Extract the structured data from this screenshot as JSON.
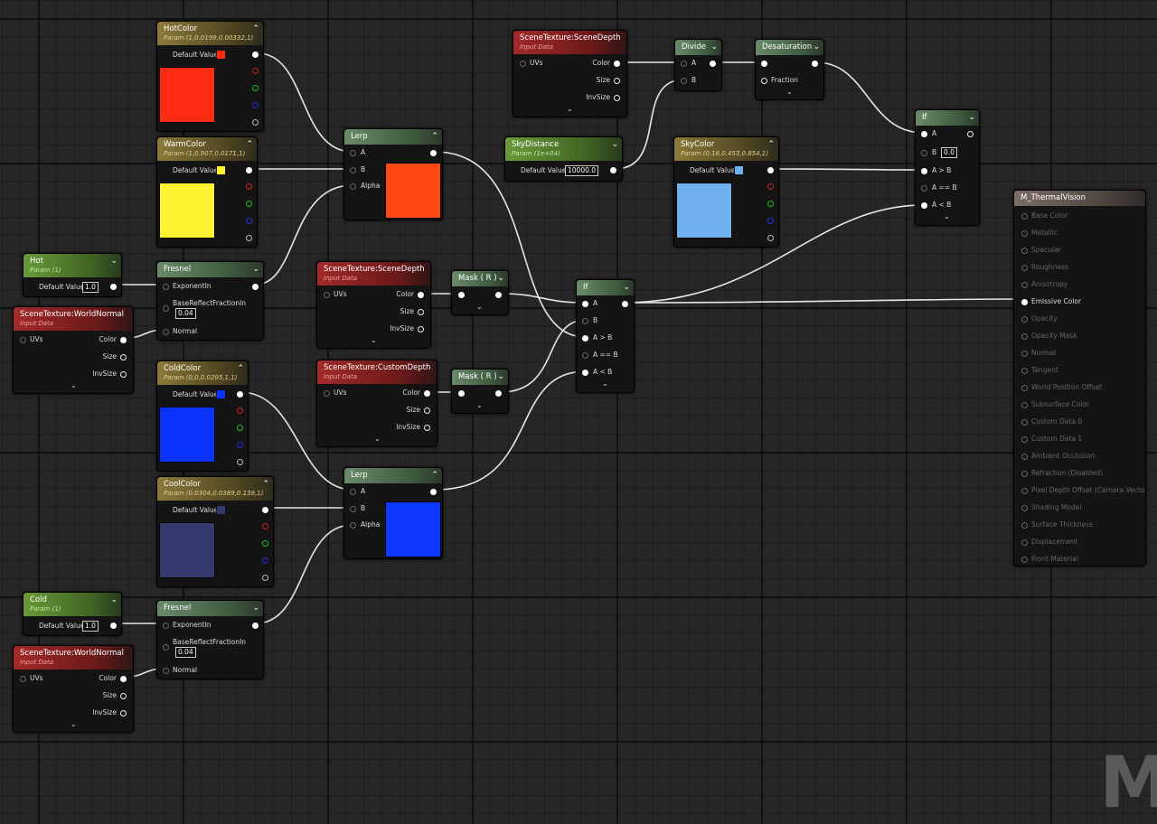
{
  "watermark": "M",
  "colors": {
    "hot": "#ff2b12",
    "warm": "#fff230",
    "cold": "#0a33ff",
    "cool": "#353a6e",
    "sky": "#6fb1ef",
    "lerp_top": "#ff4a14",
    "lerp_bot": "#0c38ff",
    "wire": "#e6e6e6"
  },
  "hot_color": {
    "title": "HotColor",
    "subtitle": "Param (1,0.0199,0.00332,1)",
    "default_label": "Default Value"
  },
  "warm_color": {
    "title": "WarmColor",
    "subtitle": "Param (1,0.907,0.0171,1)",
    "default_label": "Default Value"
  },
  "cold_color": {
    "title": "ColdColor",
    "subtitle": "Param (0,0,0.0295,1,1)",
    "default_label": "Default Value"
  },
  "cool_color": {
    "title": "CoolColor",
    "subtitle": "Param (0.0304,0.0389,0.139,1)",
    "default_label": "Default Value"
  },
  "hot_param": {
    "title": "Hot",
    "subtitle": "Param (1)",
    "default_label": "Default Value",
    "value": "1.0"
  },
  "cold_param": {
    "title": "Cold",
    "subtitle": "Param (1)",
    "default_label": "Default Value",
    "value": "1.0"
  },
  "world_normal_1": {
    "title": "SceneTexture:WorldNormal",
    "subtitle": "Input Data",
    "uvs": "UVs",
    "color": "Color",
    "size": "Size",
    "invsize": "InvSize"
  },
  "world_normal_2": {
    "title": "SceneTexture:WorldNormal",
    "subtitle": "Input Data",
    "uvs": "UVs",
    "color": "Color",
    "size": "Size",
    "invsize": "InvSize"
  },
  "fresnel_1": {
    "title": "Fresnel",
    "exponent": "ExponentIn",
    "base": "BaseReflectFractionIn",
    "base_value": "0.04",
    "normal": "Normal"
  },
  "fresnel_2": {
    "title": "Fresnel",
    "exponent": "ExponentIn",
    "base": "BaseReflectFractionIn",
    "base_value": "0.04",
    "normal": "Normal"
  },
  "lerp_1": {
    "title": "Lerp",
    "a": "A",
    "b": "B",
    "alpha": "Alpha"
  },
  "lerp_2": {
    "title": "Lerp",
    "a": "A",
    "b": "B",
    "alpha": "Alpha"
  },
  "scene_depth_1": {
    "title": "SceneTexture:SceneDepth",
    "subtitle": "Input Data",
    "uvs": "UVs",
    "color": "Color",
    "size": "Size",
    "invsize": "InvSize"
  },
  "scene_depth_2": {
    "title": "SceneTexture:SceneDepth",
    "subtitle": "Input Data",
    "uvs": "UVs",
    "color": "Color",
    "size": "Size",
    "invsize": "InvSize"
  },
  "custom_depth": {
    "title": "SceneTexture:CustomDepth",
    "subtitle": "Input Data",
    "uvs": "UVs",
    "color": "Color",
    "size": "Size",
    "invsize": "InvSize"
  },
  "mask_1": {
    "title": "Mask ( R )"
  },
  "mask_2": {
    "title": "Mask ( R )"
  },
  "if_main": {
    "title": "If",
    "a": "A",
    "b": "B",
    "agb": "A > B",
    "aeb": "A == B",
    "alb": "A < B"
  },
  "if_top": {
    "title": "If",
    "a": "A",
    "b": "B",
    "b_value": "0.0",
    "agb": "A > B",
    "aeb": "A == B",
    "alb": "A < B"
  },
  "sky_distance": {
    "title": "SkyDistance",
    "subtitle": "Param (1e+04)",
    "default_label": "Default Value",
    "value": "10000.0"
  },
  "sky_color": {
    "title": "SkyColor",
    "subtitle": "Param (0.16,0.453,0.854,1)",
    "default_label": "Default Value"
  },
  "divide": {
    "title": "Divide",
    "a": "A",
    "b": "B"
  },
  "desaturation": {
    "title": "Desaturation",
    "fraction": "Fraction"
  },
  "result": {
    "title": "M_ThermalVision",
    "pins": [
      "Base Color",
      "Metallic",
      "Specular",
      "Roughness",
      "Anisotropy",
      "Emissive Color",
      "Opacity",
      "Opacity Mask",
      "Normal",
      "Tangent",
      "World Position Offset",
      "Subsurface Color",
      "Custom Data 0",
      "Custom Data 1",
      "Ambient Occlusion",
      "Refraction (Disabled)",
      "Pixel Depth Offset (Camera Vector)",
      "Shading Model",
      "Surface Thickness",
      "Displacement",
      "Front Material"
    ],
    "active_index": 5
  },
  "icons": {
    "collapse": "chevron-up-icon",
    "expand": "chevron-down-icon"
  }
}
